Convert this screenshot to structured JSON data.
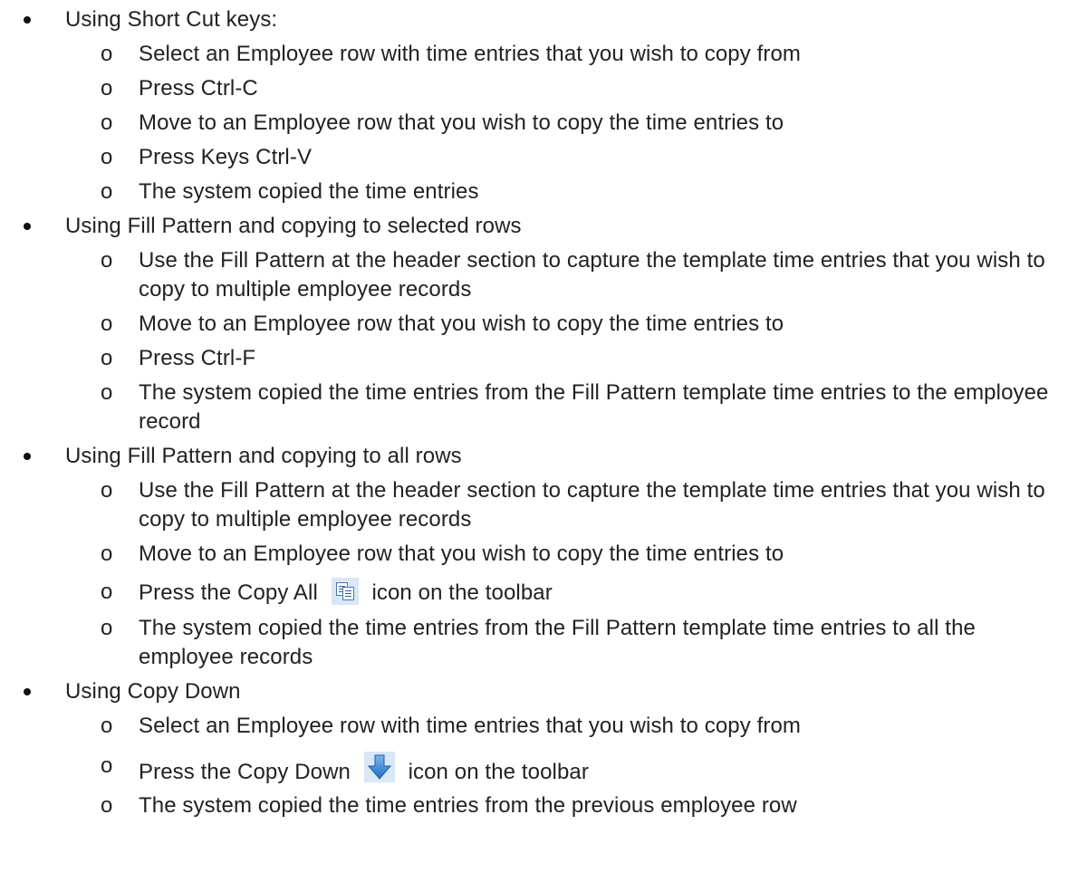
{
  "sections": [
    {
      "title": "Using Short Cut keys:",
      "items": [
        "Select an Employee row with time entries that you wish to copy from",
        "Press Ctrl-C",
        "Move to an Employee row that you wish to copy the time entries to",
        "Press Keys Ctrl-V",
        "The system copied the time entries"
      ]
    },
    {
      "title": "Using Fill Pattern and copying to selected rows",
      "items": [
        "Use the Fill Pattern at the header section to capture the template time entries that you wish to copy to multiple employee records",
        "Move to an Employee row that you wish to copy the time entries to",
        "Press Ctrl-F",
        "The system copied the time entries from the Fill Pattern template time entries to the employee record"
      ]
    },
    {
      "title": "Using Fill Pattern and copying to all rows",
      "items": [
        "Use the Fill Pattern at the header section to capture the template time entries that you wish to copy to multiple employee records",
        "Move to an Employee row that you wish to copy the time entries to",
        {
          "before": "Press the Copy All",
          "icon": "copy-all-icon",
          "after": "icon on the toolbar"
        },
        "The system copied the time entries from the Fill Pattern template time entries to all the employee records"
      ]
    },
    {
      "title": "Using Copy Down",
      "items": [
        "Select an Employee row with time entries that you wish to copy from",
        {
          "before": "Press the Copy Down",
          "icon": "copy-down-arrow-icon",
          "after": "icon on the toolbar"
        },
        "The system copied the time entries from the previous employee row"
      ]
    }
  ],
  "sub_marker": "o",
  "colors": {
    "text": "#222222",
    "icon_background": "#d9e7f6",
    "arrow_blue": "#2f7fd6"
  }
}
